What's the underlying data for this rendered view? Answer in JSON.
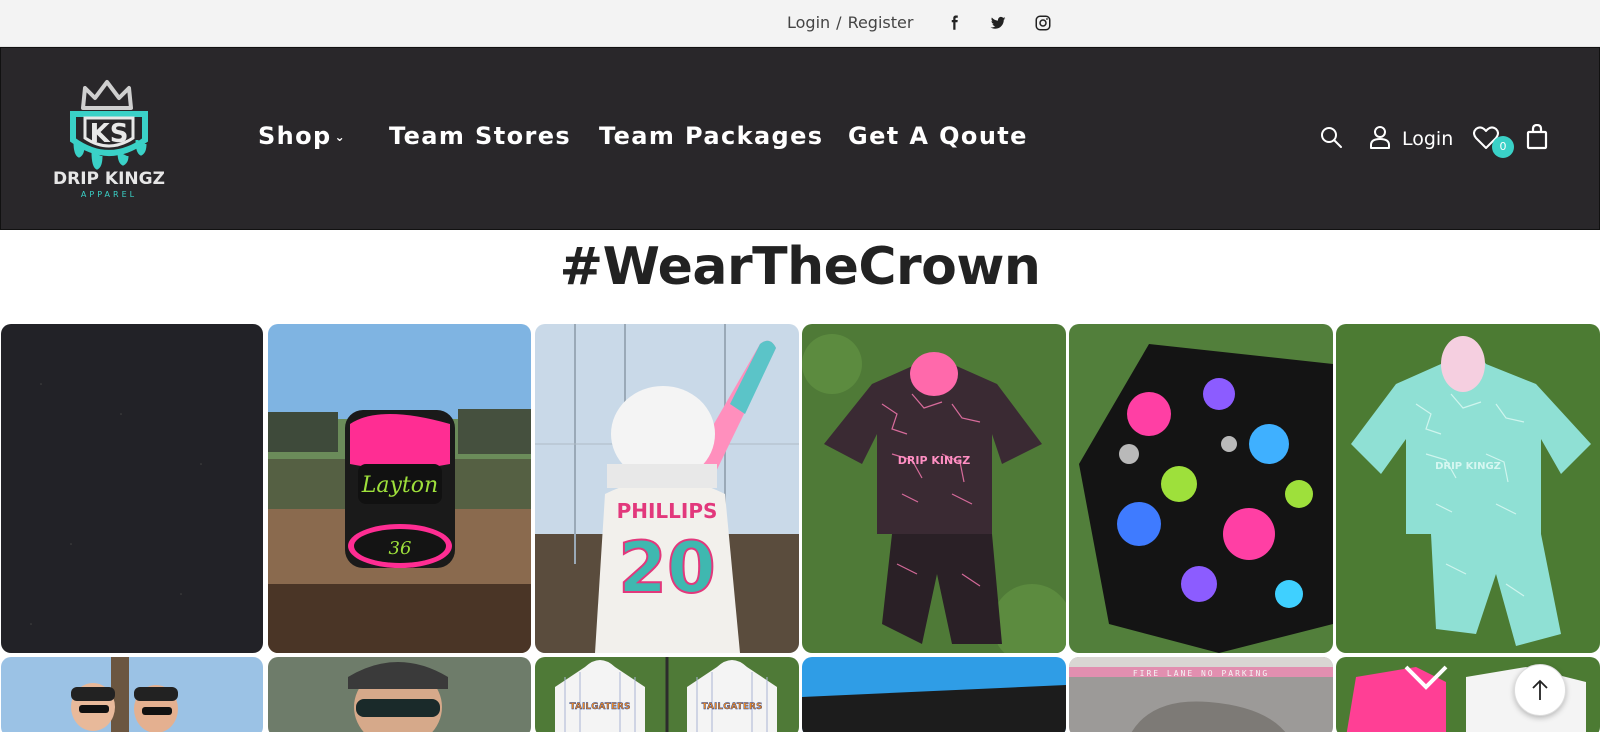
{
  "topbar": {
    "login": "Login",
    "separator": "/",
    "register": "Register",
    "social": [
      "facebook-icon",
      "twitter-icon",
      "instagram-icon"
    ]
  },
  "header": {
    "logo_text": "DRIP KINGZ",
    "logo_subtext": "APPAREL",
    "nav": {
      "shop": "Shop",
      "team_stores": "Team Stores",
      "team_packages": "Team Packages",
      "get_quote": "Get A Qoute"
    },
    "login_label": "Login",
    "wishlist_count": "0"
  },
  "main": {
    "hashtag": "#WearTheCrown",
    "tiles": {
      "backpack_name": "Layton",
      "backpack_number": "36",
      "jersey_name": "PHILLIPS",
      "jersey_number": "20",
      "hoodie_brand": "DRIP KINGZ",
      "tailgaters_1": "TAILGATERS",
      "tailgaters_2": "TAILGATERS",
      "fire_lane_text": "FIRE LANE NO PARKING"
    }
  },
  "colors": {
    "header_bg": "#29272a",
    "accent_teal": "#3ad1c7",
    "accent_pink": "#ff3fa4",
    "topbar_bg": "#f3f3f3"
  }
}
